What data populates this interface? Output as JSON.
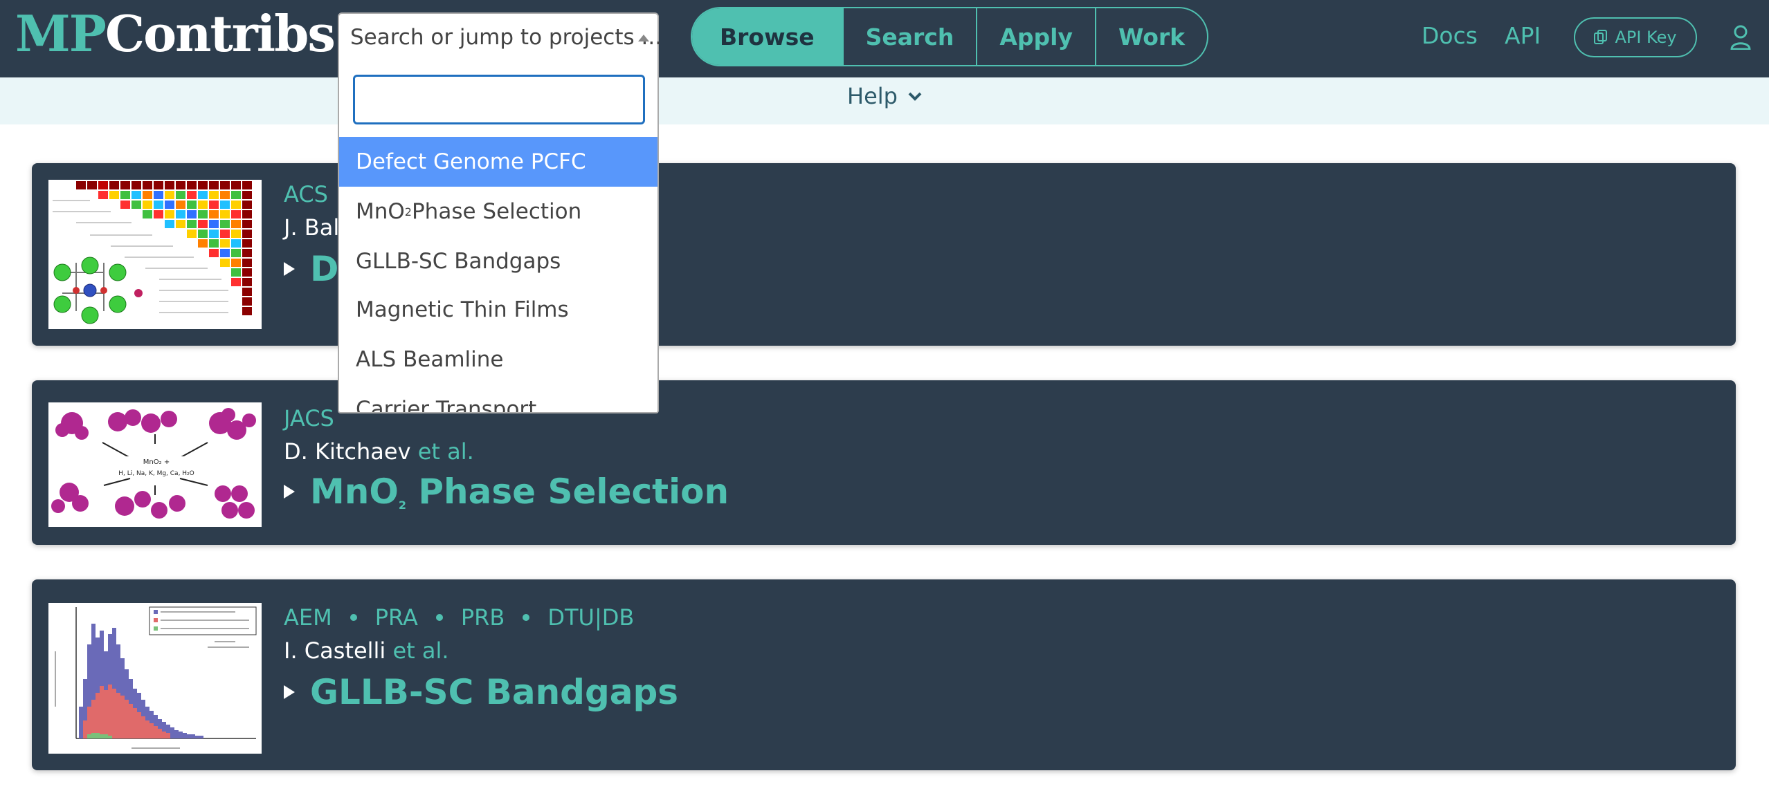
{
  "header": {
    "logo_mp": "MP",
    "logo_contribs": "Contribs",
    "search_placeholder": "Search or jump to projects ...",
    "nav": [
      "Browse",
      "Search",
      "Apply",
      "Work"
    ],
    "links": {
      "docs": "Docs",
      "api": "API"
    },
    "api_key_label": "API Key",
    "help_label": "Help"
  },
  "dropdown": {
    "search_value": "",
    "options": [
      {
        "label": "Defect Genome PCFC",
        "selected": true
      },
      {
        "label": "MnO",
        "sub": "2",
        "suffix": " Phase Selection",
        "selected": false
      },
      {
        "label": "GLLB-SC Bandgaps",
        "selected": false
      },
      {
        "label": "Magnetic Thin Films",
        "selected": false
      },
      {
        "label": "ALS Beamline",
        "selected": false
      },
      {
        "label": "Carrier Transport",
        "selected": false
      }
    ]
  },
  "projects": [
    {
      "journals": [
        "ACS"
      ],
      "author": "J. Bala",
      "etal": "",
      "title": "D"
    },
    {
      "journals": [
        "JACS"
      ],
      "author": "D. Kitchaev",
      "etal": "et al.",
      "title_main": "MnO",
      "title_sub": "2",
      "title_suffix": " Phase Selection"
    },
    {
      "journals": [
        "AEM",
        "PRA",
        "PRB",
        "DTU|DB"
      ],
      "author": "I. Castelli",
      "etal": "et al.",
      "title": "GLLB-SC Bandgaps"
    }
  ],
  "colors": {
    "topbar": "#2d3d4d",
    "accent": "#4fc0b0",
    "selected_option": "#5897fb",
    "subbar": "#eaf6f8"
  },
  "icons": {
    "select_arrow": "caret-up-icon",
    "help_chevron": "chevron-down-icon",
    "api_key": "copy-icon",
    "user": "user-icon",
    "expand": "triangle-right-icon"
  }
}
